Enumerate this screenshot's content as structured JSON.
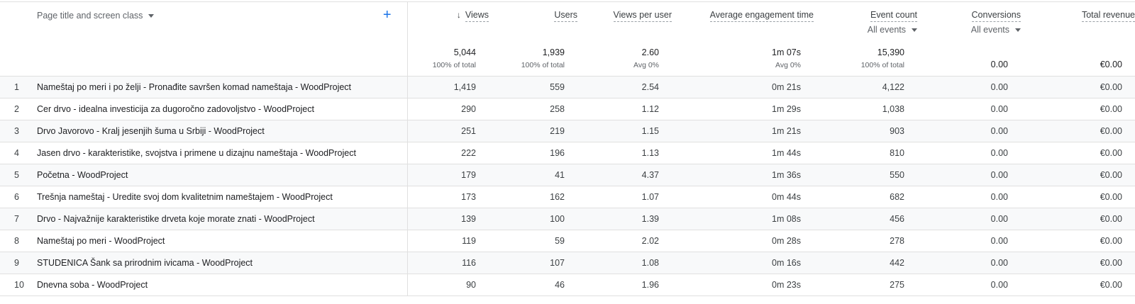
{
  "header": {
    "dimension_label": "Page title and screen class",
    "add_icon": "plus-icon",
    "columns": [
      {
        "key": "views",
        "label": "Views",
        "sorted": true,
        "total": "5,044",
        "sub": "100% of total"
      },
      {
        "key": "users",
        "label": "Users",
        "total": "1,939",
        "sub": "100% of total"
      },
      {
        "key": "vpu",
        "label": "Views per user",
        "total": "2.60",
        "sub": "Avg 0%"
      },
      {
        "key": "aet",
        "label": "Average engagement time",
        "total": "1m 07s",
        "sub": "Avg 0%"
      },
      {
        "key": "events",
        "label": "Event count",
        "selector": "All events",
        "total": "15,390",
        "sub": "100% of total"
      },
      {
        "key": "conv",
        "label": "Conversions",
        "selector": "All events",
        "total": "0.00",
        "sub": ""
      },
      {
        "key": "rev",
        "label": "Total revenue",
        "total": "€0.00",
        "sub": ""
      }
    ]
  },
  "rows": [
    {
      "idx": "1",
      "page": "Nameštaj po meri i po želji - Pronađite savršen komad nameštaja - WoodProject",
      "views": "1,419",
      "users": "559",
      "vpu": "2.54",
      "aet": "0m 21s",
      "events": "4,122",
      "conv": "0.00",
      "rev": "€0.00"
    },
    {
      "idx": "2",
      "page": "Cer drvo - idealna investicija za dugoročno zadovoljstvo - WoodProject",
      "views": "290",
      "users": "258",
      "vpu": "1.12",
      "aet": "1m 29s",
      "events": "1,038",
      "conv": "0.00",
      "rev": "€0.00"
    },
    {
      "idx": "3",
      "page": "Drvo Javorovo - Kralj jesenjih šuma u Srbiji - WoodProject",
      "views": "251",
      "users": "219",
      "vpu": "1.15",
      "aet": "1m 21s",
      "events": "903",
      "conv": "0.00",
      "rev": "€0.00"
    },
    {
      "idx": "4",
      "page": "Jasen drvo - karakteristike, svojstva i primene u dizajnu nameštaja - WoodProject",
      "views": "222",
      "users": "196",
      "vpu": "1.13",
      "aet": "1m 44s",
      "events": "810",
      "conv": "0.00",
      "rev": "€0.00"
    },
    {
      "idx": "5",
      "page": "Početna - WoodProject",
      "views": "179",
      "users": "41",
      "vpu": "4.37",
      "aet": "1m 36s",
      "events": "550",
      "conv": "0.00",
      "rev": "€0.00"
    },
    {
      "idx": "6",
      "page": "Trešnja nameštaj - Uredite svoj dom kvalitetnim nameštajem - WoodProject",
      "views": "173",
      "users": "162",
      "vpu": "1.07",
      "aet": "0m 44s",
      "events": "682",
      "conv": "0.00",
      "rev": "€0.00"
    },
    {
      "idx": "7",
      "page": "Drvo - Najvažnije karakteristike drveta koje morate znati - WoodProject",
      "views": "139",
      "users": "100",
      "vpu": "1.39",
      "aet": "1m 08s",
      "events": "456",
      "conv": "0.00",
      "rev": "€0.00"
    },
    {
      "idx": "8",
      "page": "Nameštaj po meri - WoodProject",
      "views": "119",
      "users": "59",
      "vpu": "2.02",
      "aet": "0m 28s",
      "events": "278",
      "conv": "0.00",
      "rev": "€0.00"
    },
    {
      "idx": "9",
      "page": "STUDENICA Šank sa prirodnim ivicama - WoodProject",
      "views": "116",
      "users": "107",
      "vpu": "1.08",
      "aet": "0m 16s",
      "events": "442",
      "conv": "0.00",
      "rev": "€0.00"
    },
    {
      "idx": "10",
      "page": "Dnevna soba - WoodProject",
      "views": "90",
      "users": "46",
      "vpu": "1.96",
      "aet": "0m 23s",
      "events": "275",
      "conv": "0.00",
      "rev": "€0.00"
    }
  ]
}
